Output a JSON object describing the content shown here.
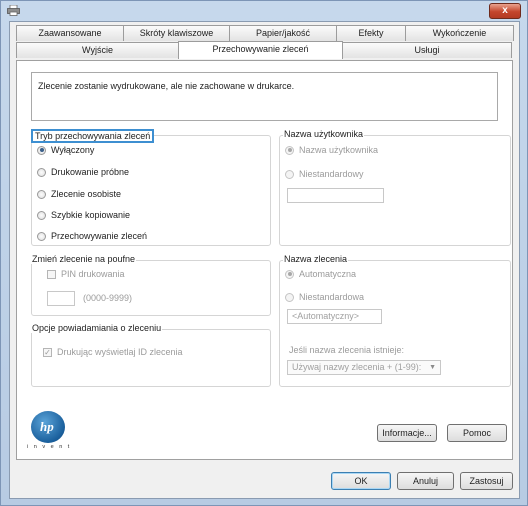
{
  "window": {
    "close_label": "x",
    "icons": {
      "app": "printer-icon",
      "close": "close-icon"
    }
  },
  "tabs_row1": [
    "Zaawansowane",
    "Skróty klawiszowe",
    "Papier/jakość",
    "Efekty",
    "Wykończenie"
  ],
  "tabs_row2": [
    "Wyjście",
    "Przechowywanie zleceń",
    "Usługi"
  ],
  "active_tab": "Przechowywanie zleceń",
  "message": "Zlecenie zostanie wydrukowane, ale nie zachowane w drukarce.",
  "storage_mode": {
    "legend": "Tryb przechowywania zleceń",
    "options": [
      "Wyłączony",
      "Drukowanie próbne",
      "Zlecenie osobiste",
      "Szybkie kopiowanie",
      "Przechowywanie zleceń"
    ],
    "selected": "Wyłączony"
  },
  "user_name": {
    "legend": "Nazwa użytkownika",
    "options": [
      "Nazwa użytkownika",
      "Niestandardowy"
    ],
    "selected": "Nazwa użytkownika",
    "custom_value": ""
  },
  "private": {
    "legend": "Zmień zlecenie na poufne",
    "pin_label": "PIN drukowania",
    "pin_range": "(0000-9999)",
    "pin_value": ""
  },
  "notify": {
    "legend": "Opcje powiadamiania o zleceniu",
    "checkbox_label": "Drukując wyświetlaj ID zlecenia",
    "checked": true
  },
  "job_name": {
    "legend": "Nazwa zlecenia",
    "options": [
      "Automatyczna",
      "Niestandardowa"
    ],
    "selected": "Automatyczna",
    "custom_value": "<Automatyczny>",
    "exists_label": "Jeśli nazwa zlecenia istnieje:",
    "exists_value": "Używaj nazwy zlecenia + (1-99):"
  },
  "logo": {
    "text": "hp",
    "tagline": "i n v e n t"
  },
  "panel_buttons": {
    "info": "Informacje...",
    "help": "Pomoc"
  },
  "dialog_buttons": {
    "ok": "OK",
    "cancel": "Anuluj",
    "apply": "Zastosuj"
  }
}
